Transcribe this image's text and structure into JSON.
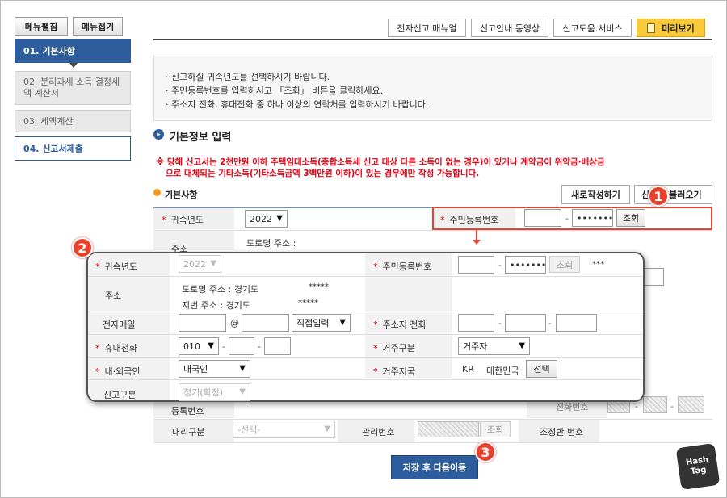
{
  "side": {
    "expand": "메뉴펼침",
    "collapse": "메뉴접기",
    "steps": [
      "01. 기본사항",
      "02. 분리과세 소득 결정세액 계산서",
      "03. 세액계산",
      "04. 신고서제출"
    ]
  },
  "top": {
    "manual": "전자신고 매뉴얼",
    "video": "신고안내 동영상",
    "help": "신고도움 서비스",
    "preview": "미리보기"
  },
  "notice": [
    "신고하실 귀속년도를 선택하시기 바랍니다.",
    "주민등록번호를 입력하시고 「조회」 버튼을 클릭하세요.",
    "주소지 전화, 휴대전화 중 하나 이상의 연락처를 입력하시기 바랍니다."
  ],
  "section_title": "기본정보 입력",
  "warning": [
    "※ 당해 신고서는 2천만원 이하 주택임대소득(종합소득세 신고 대상 다른 소득이 없는 경우)이 있거나 계약금이 위약금·배상금",
    "으로 대체되는 기타소득(기타소득금액 3백만원 이하)이 있는 경우에만 작성 가능합니다."
  ],
  "sub_title": "기본사항",
  "btn_new": "새로작성하기",
  "btn_load_a": "신",
  "btn_load_b": "불러오기",
  "form": {
    "year_label": "귀속년도",
    "year_value": "2022",
    "rrn_label": "주민등록번호",
    "rrn_back": "•••••••",
    "lookup": "조회",
    "addr_label": "주소",
    "road_addr": "도로명 주소 :",
    "agent_label": "대리구분",
    "agent_value": "-선택-",
    "mgmt_label": "관리번호",
    "adj_label": "조정반 번호",
    "reg_label": "등록번호",
    "phone_label": "전화번호"
  },
  "popup": {
    "year_label": "귀속년도",
    "year_value": "2022",
    "rrn_label": "주민등록번호",
    "rrn_back": "•••••••",
    "lookup": "조회",
    "rrn_mask": "***",
    "addr_label": "주소",
    "road": "도로명 주소 :",
    "road_val": "경기도",
    "road_mask": "*****",
    "lot": "지번 주소 :",
    "lot_val": "경기도",
    "lot_mask": "*****",
    "email_label": "전자메일",
    "at": "@",
    "email_domain": "직접입력",
    "home_phone_label": "주소지 전화",
    "mobile_label": "휴대전화",
    "mobile_prefix": "010",
    "residence_label": "거주구분",
    "residence_value": "거주자",
    "nation_label": "내·외국인",
    "nation_value": "내국인",
    "country_label": "거주지국",
    "country_code": "KR",
    "country_name": "대한민국",
    "select_btn": "선택",
    "type_label": "신고구분",
    "type_value": "정기(확정)"
  },
  "save_btn": "저장 후 다음이동",
  "badges": [
    "1",
    "2",
    "3"
  ],
  "watermark": [
    "Hash",
    "Tag"
  ]
}
